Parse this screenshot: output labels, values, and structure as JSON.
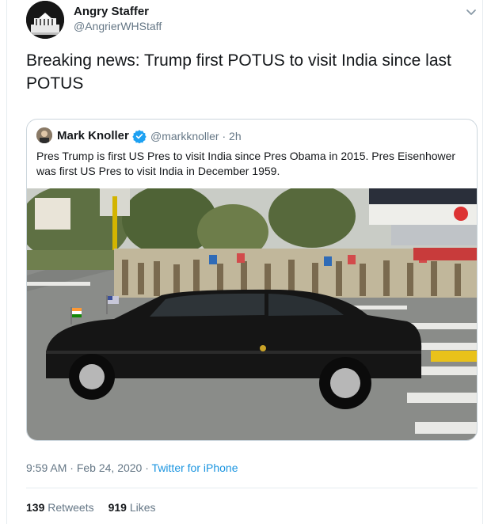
{
  "author": {
    "name": "Angry Staffer",
    "handle": "@AngrierWHStaff"
  },
  "tweet": {
    "text": "Breaking news: Trump first POTUS to visit India since last POTUS"
  },
  "quoted": {
    "name": "Mark Knoller",
    "handle": "@markknoller",
    "separator": "·",
    "age": "2h",
    "text": "Pres Trump is first US Pres to visit India since Pres Obama in 2015. Pres Eisenhower was first US Pres to visit India in December 1959."
  },
  "meta": {
    "time": "9:59 AM",
    "separator": "·",
    "date": "Feb 24, 2020",
    "source": "Twitter for iPhone"
  },
  "stats": {
    "retweets_count": "139",
    "retweets_label": "Retweets",
    "likes_count": "919",
    "likes_label": "Likes"
  },
  "colors": {
    "link": "#1b95e0",
    "muted": "#657786",
    "verified": "#1da1f2"
  },
  "icons": [
    "white-house-avatar-icon",
    "chevron-down-icon",
    "verified-badge-icon"
  ]
}
